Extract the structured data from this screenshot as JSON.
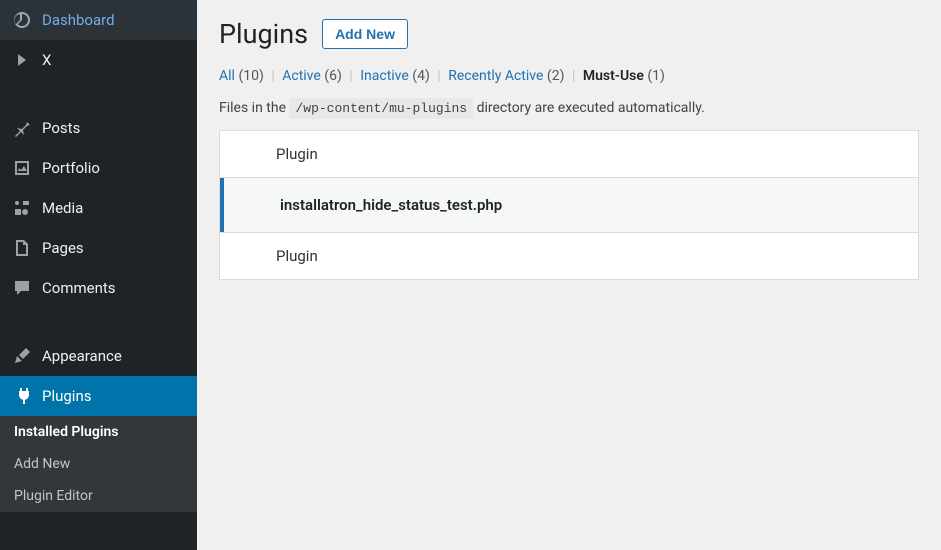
{
  "sidebar": {
    "items": [
      {
        "label": "Dashboard"
      },
      {
        "label": "X"
      },
      {
        "label": "Posts"
      },
      {
        "label": "Portfolio"
      },
      {
        "label": "Media"
      },
      {
        "label": "Pages"
      },
      {
        "label": "Comments"
      },
      {
        "label": "Appearance"
      },
      {
        "label": "Plugins"
      }
    ],
    "submenu": [
      {
        "label": "Installed Plugins"
      },
      {
        "label": "Add New"
      },
      {
        "label": "Plugin Editor"
      }
    ]
  },
  "header": {
    "title": "Plugins",
    "add_new": "Add New"
  },
  "filters": {
    "all_label": "All",
    "all_count": "(10)",
    "active_label": "Active",
    "active_count": "(6)",
    "inactive_label": "Inactive",
    "inactive_count": "(4)",
    "recent_label": "Recently Active",
    "recent_count": "(2)",
    "mustuse_label": "Must-Use",
    "mustuse_count": "(1)"
  },
  "info": {
    "prefix": "Files in the ",
    "path": "/wp-content/mu-plugins",
    "suffix": " directory are executed automatically."
  },
  "table": {
    "header": "Plugin",
    "row1": "installatron_hide_status_test.php",
    "footer": "Plugin"
  }
}
